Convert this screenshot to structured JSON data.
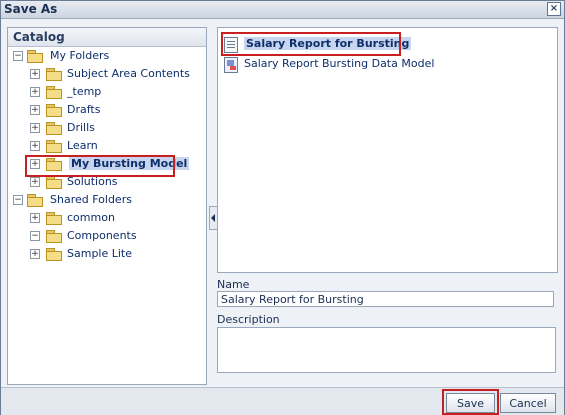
{
  "dialog": {
    "title": "Save As",
    "close_glyph": "×"
  },
  "catalog": {
    "title": "Catalog",
    "tree": [
      {
        "label": "My Folders",
        "expander": "−"
      },
      {
        "label": "Subject Area Contents",
        "expander": "+"
      },
      {
        "label": "_temp",
        "expander": "+"
      },
      {
        "label": "Drafts",
        "expander": "+"
      },
      {
        "label": "Drills",
        "expander": "+"
      },
      {
        "label": "Learn",
        "expander": "+"
      },
      {
        "label": "My Bursting Model",
        "expander": "+"
      },
      {
        "label": "Solutions",
        "expander": "+"
      },
      {
        "label": "Shared Folders",
        "expander": "−"
      },
      {
        "label": "common",
        "expander": "+"
      },
      {
        "label": "Components",
        "expander": "−"
      },
      {
        "label": "Sample Lite",
        "expander": "+"
      }
    ]
  },
  "files": [
    {
      "label": "Salary Report for Bursting",
      "icon": "report-icon"
    },
    {
      "label": "Salary Report Bursting Data Model",
      "icon": "data-model-icon"
    }
  ],
  "form": {
    "name_label": "Name",
    "name_value": "Salary Report for Bursting",
    "description_label": "Description"
  },
  "buttons": {
    "save": "Save",
    "cancel": "Cancel"
  }
}
